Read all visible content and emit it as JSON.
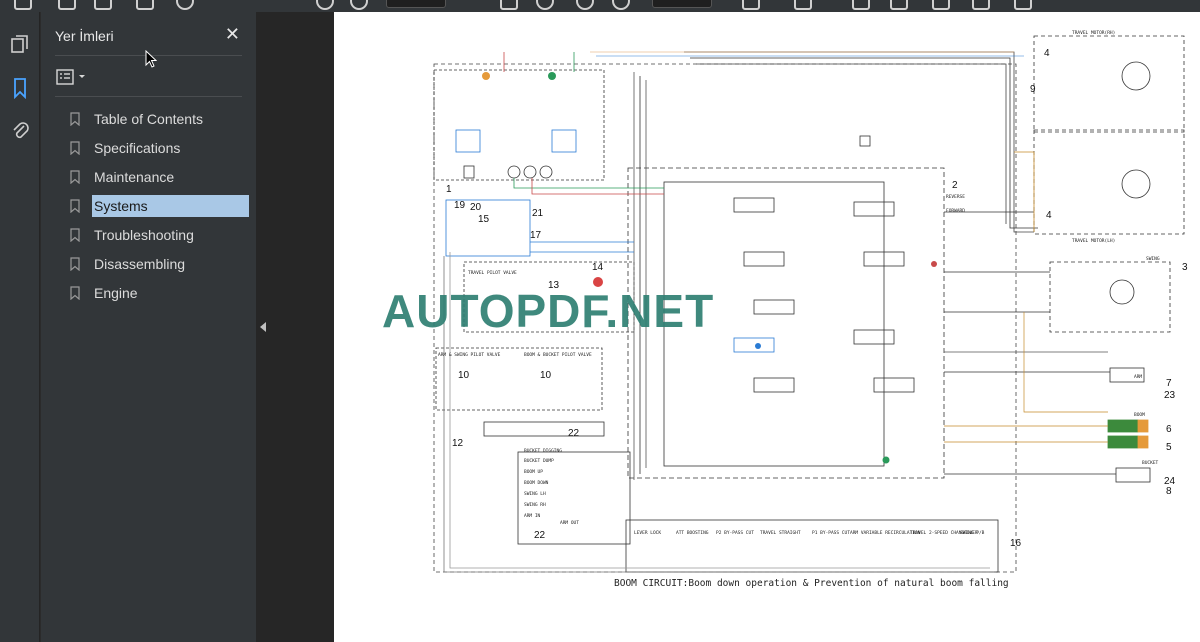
{
  "toolbar": {
    "page_field": "—",
    "zoom_field": "—"
  },
  "sidebar_rail": {
    "icons": [
      "pages-icon",
      "bookmark-icon",
      "attachment-icon"
    ]
  },
  "bookmarks_panel": {
    "title": "Yer İmleri",
    "close_label": "✕",
    "items": [
      {
        "label": "Table of Contents",
        "selected": false
      },
      {
        "label": "Specifications",
        "selected": false
      },
      {
        "label": "Maintenance",
        "selected": false
      },
      {
        "label": "Systems",
        "selected": true
      },
      {
        "label": "Troubleshooting",
        "selected": false
      },
      {
        "label": "Disassembling",
        "selected": false
      },
      {
        "label": "Engine",
        "selected": false
      }
    ]
  },
  "document": {
    "watermark": "AUTOPDF.NET",
    "caption": "BOOM CIRCUIT:Boom down operation & Prevention of natural boom falling",
    "callouts": [
      "1",
      "2",
      "3",
      "4",
      "4",
      "5",
      "6",
      "7",
      "8",
      "9",
      "10",
      "10",
      "12",
      "13",
      "14",
      "15",
      "16",
      "17",
      "19",
      "20",
      "21",
      "22",
      "22",
      "23",
      "24"
    ],
    "labels": {
      "travel_motor_rh": "TRAVEL MOTOR(RH)",
      "travel_motor_lh": "TRAVEL MOTOR(LH)",
      "arm": "ARM",
      "boom": "BOOM",
      "bucket": "BUCKET",
      "swing": "SWING",
      "reverse": "REVERSE",
      "forward": "FORWARD",
      "travel_pilot_valve": "TRAVEL PILOT VALVE",
      "arm_swing_pilot": "ARM & SWING PILOT VALVE",
      "boom_bucket_pilot": "BOOM & BUCKET PILOT VALVE",
      "bucket_digging": "BUCKET DIGGING",
      "bucket_dump": "BUCKET DUMP",
      "boom_up": "BOOM UP",
      "boom_down": "BOOM DOWN",
      "swing_lh": "SWING LH",
      "swing_rh": "SWING RH",
      "arm_in": "ARM IN",
      "arm_out": "ARM OUT",
      "lever_lock": "LEVER LOCK",
      "att_boosting": "ATT BOOSTING",
      "p2_bypass_cut": "P2 BY-PASS CUT",
      "travel_straight": "TRAVEL STRAIGHT",
      "p1_bypass_cut": "P1 BY-PASS CUT",
      "arm_variable_recirc": "ARM VARIABLE RECIRCULATION",
      "travel_2speed": "TRAVEL 2-SPEED CHANGEOVER",
      "swing_pb": "SWING P/B"
    }
  }
}
